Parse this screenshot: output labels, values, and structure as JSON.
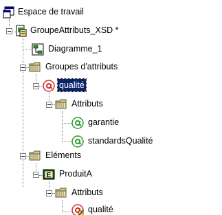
{
  "tree": {
    "root": {
      "label": "Espace de travail",
      "icon": "workspace-icon"
    },
    "schema": {
      "label": "GroupeAttributs_XSD *",
      "icon": "schema-document-icon"
    },
    "diagram": {
      "label": "Diagramme_1",
      "icon": "diagram-icon"
    },
    "attribute_groups_folder": {
      "label": "Groupes d'attributs",
      "icon": "folder-icon"
    },
    "attribute_group_quality": {
      "label": "qualité",
      "icon": "attribute-group-icon",
      "selected": true
    },
    "attributes_folder_1": {
      "label": "Attributs",
      "icon": "folder-icon"
    },
    "attr_guarantee": {
      "label": "garantie",
      "icon": "attribute-icon"
    },
    "attr_quality_standards": {
      "label": "standardsQualité",
      "icon": "attribute-icon"
    },
    "elements_folder": {
      "label": "Eléments",
      "icon": "folder-icon"
    },
    "element_product": {
      "label": "ProduitA",
      "icon": "element-icon",
      "badge": "E"
    },
    "attributes_folder_2": {
      "label": "Attributs",
      "icon": "folder-icon"
    },
    "attr_group_ref_quality": {
      "label": "qualité",
      "icon": "attribute-group-reference-icon"
    }
  },
  "colors": {
    "selection_bg": "#0a246a",
    "folder": "#d4c98a",
    "attribute_green": "#2e9a2e",
    "attribute_group_red": "#d03030",
    "element_green": "#107010"
  }
}
